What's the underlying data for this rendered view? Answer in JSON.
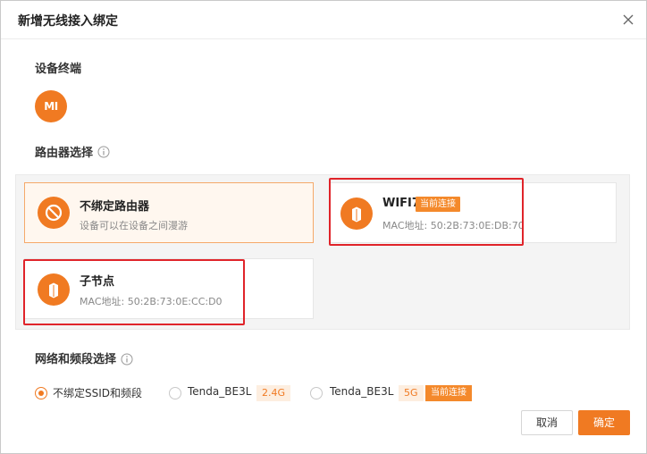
{
  "dialog": {
    "title": "新增无线接入绑定",
    "close_icon": "close-icon"
  },
  "device_section": {
    "label": "设备终端",
    "device_icon": "xiaomi-logo-icon",
    "device_icon_text": "MI"
  },
  "router_section": {
    "label": "路由器选择",
    "info_icon": "info-icon",
    "options": [
      {
        "title": "不绑定路由器",
        "subtitle": "设备可以在设备之间漫游",
        "icon": "forbidden-icon",
        "selected": true
      },
      {
        "title": "WIFI7",
        "badge": "当前连接",
        "subtitle": "MAC地址: 50:2B:73:0E:DB:70",
        "icon": "router-icon",
        "selected": false
      },
      {
        "title": "子节点",
        "subtitle": "MAC地址: 50:2B:73:0E:CC:D0",
        "icon": "router-icon",
        "selected": false
      }
    ]
  },
  "network_section": {
    "label": "网络和频段选择",
    "info_icon": "info-icon",
    "options": [
      {
        "label": "不绑定SSID和频段",
        "checked": true
      },
      {
        "label": "Tenda_BE3L",
        "band": "2.4G",
        "checked": false
      },
      {
        "label": "Tenda_BE3L",
        "band": "5G",
        "badge": "当前连接",
        "checked": false
      }
    ]
  },
  "footer": {
    "cancel_label": "取消",
    "ok_label": "确定"
  },
  "colors": {
    "accent": "#f07a22",
    "highlight_border": "#e0242a"
  }
}
